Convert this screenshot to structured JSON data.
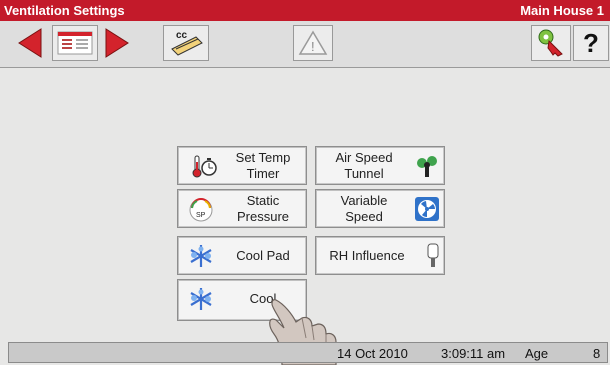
{
  "title": {
    "left": "Ventilation Settings",
    "right": "Main House 1"
  },
  "toolbar": {
    "items": [
      {
        "name": "back-arrow-icon"
      },
      {
        "name": "list-view-icon"
      },
      {
        "name": "forward-arrow-icon"
      },
      {
        "name": "cc-pencil-icon",
        "label": "cc"
      },
      {
        "name": "warning-icon",
        "label": "!"
      },
      {
        "name": "key-icon"
      },
      {
        "name": "help-icon",
        "label": "?"
      }
    ]
  },
  "buttons": {
    "set_temp_timer": "Set Temp\nTimer",
    "air_speed_tunnel": "Air Speed\nTunnel",
    "static_pressure": "Static\nPressure",
    "variable_speed": "Variable\nSpeed",
    "cool_pad": "Cool Pad",
    "rh_influence": "RH Influence",
    "cool": "Cool",
    "sp_badge": "SP"
  },
  "status": {
    "date": "14 Oct 2010",
    "time": "3:09:11 am",
    "age_label": "Age",
    "age_value": "8"
  },
  "colors": {
    "title_bar": "#c31a2a",
    "accent_red": "#d3232c",
    "fan_blue": "#2f72c9",
    "cool_blue": "#3a6fd0"
  }
}
